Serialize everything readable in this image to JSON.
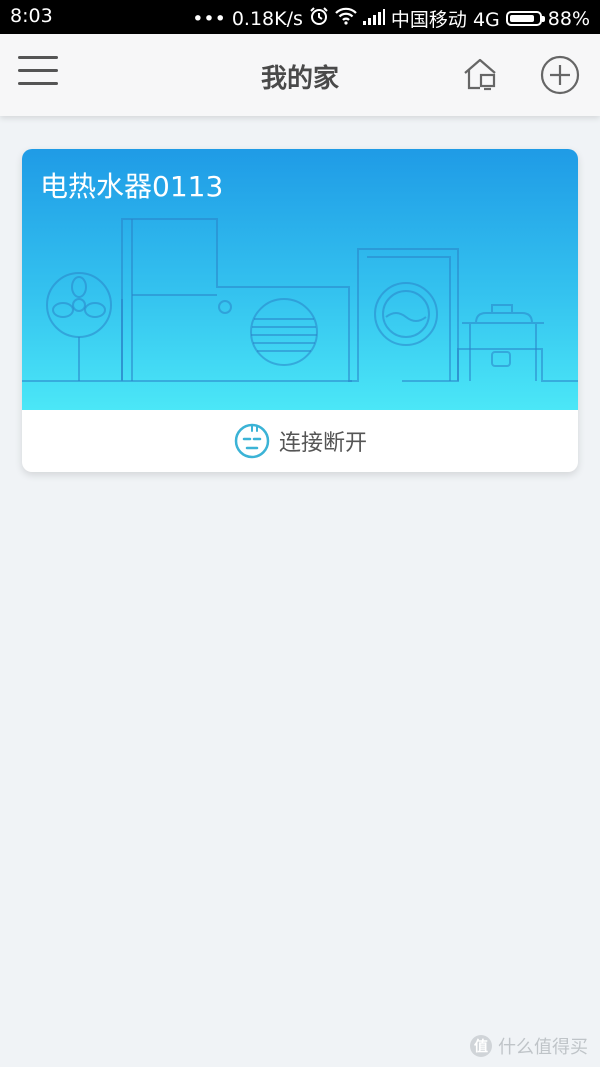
{
  "statusbar": {
    "time": "8:03",
    "network_speed": "0.18K/s",
    "carrier": "中国移动 4G",
    "battery": "88%",
    "battery_level": 0.88
  },
  "header": {
    "title": "我的家",
    "menu_icon": "hamburger-icon",
    "home_icon": "home-icon",
    "add_icon": "plus-circle-icon"
  },
  "devices": [
    {
      "name": "电热水器0113",
      "status": "连接断开",
      "status_icon": "disconnected-face-icon"
    }
  ],
  "watermark": {
    "text": "什么值得买",
    "logo_char": "值"
  },
  "colors": {
    "card_gradient_top": "#1f9be6",
    "card_gradient_bottom": "#4be7f7",
    "status_icon": "#3bb3d6",
    "background": "#f0f3f6"
  }
}
